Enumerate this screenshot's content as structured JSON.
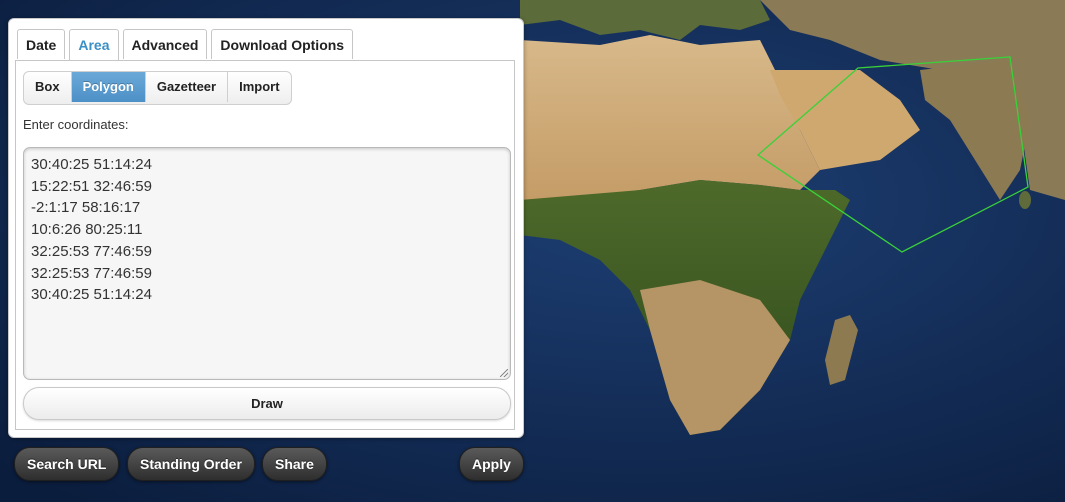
{
  "tabs": [
    {
      "label": "Date"
    },
    {
      "label": "Area",
      "active": true
    },
    {
      "label": "Advanced"
    },
    {
      "label": "Download Options"
    }
  ],
  "area": {
    "subtabs": [
      {
        "label": "Box"
      },
      {
        "label": "Polygon",
        "active": true
      },
      {
        "label": "Gazetteer"
      },
      {
        "label": "Import"
      }
    ],
    "coordinates_label": "Enter coordinates:",
    "coordinates": [
      "30:40:25 51:14:24",
      "15:22:51 32:46:59",
      "-2:1:17 58:16:17",
      "10:6:26 80:25:11",
      "32:25:53 77:46:59",
      "32:25:53 77:46:59",
      "30:40:25 51:14:24"
    ],
    "draw_label": "Draw"
  },
  "footer": {
    "search_url_label": "Search URL",
    "standing_order_label": "Standing Order",
    "share_label": "Share",
    "apply_label": "Apply"
  },
  "map": {
    "polygon_color": "#39d139"
  },
  "colors": {
    "accent": "#4d90c7",
    "active_tab_text": "#3a8fc4"
  }
}
